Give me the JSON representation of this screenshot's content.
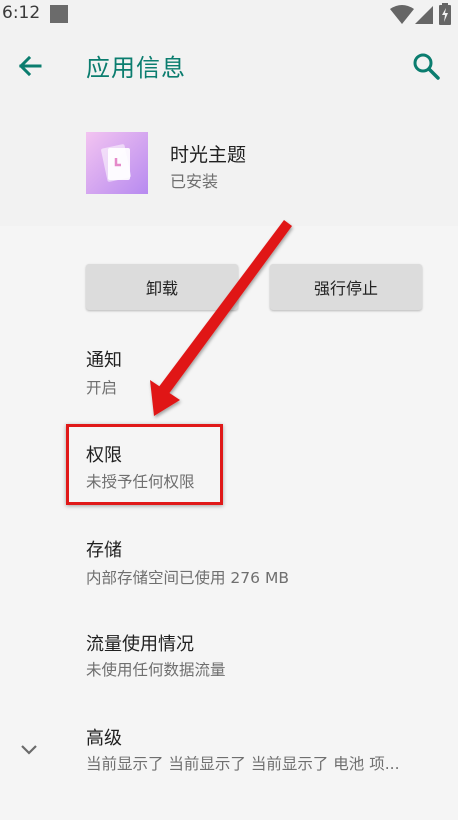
{
  "status_bar": {
    "time": "6:12",
    "icons": [
      "notification-square-icon",
      "wifi-icon",
      "cellular-signal-icon",
      "battery-charging-icon"
    ]
  },
  "app_bar": {
    "title": "应用信息",
    "back_icon": "arrow-back-icon",
    "search_icon": "search-icon"
  },
  "app": {
    "name": "时光主题",
    "status": "已安装"
  },
  "buttons": {
    "uninstall": "卸载",
    "force_stop": "强行停止"
  },
  "prefs": [
    {
      "title": "通知",
      "summary": "开启"
    },
    {
      "title": "权限",
      "summary": "未授予任何权限"
    },
    {
      "title": "存储",
      "summary": "内部存储空间已使用 276 MB"
    },
    {
      "title": "流量使用情况",
      "summary": "未使用任何数据流量"
    },
    {
      "title": "高级",
      "summary": "当前显示了 当前显示了 当前显示了 电池 项..."
    }
  ],
  "colors": {
    "accent": "#0b7d6f",
    "annotation": "#e01818",
    "app_icon_gradient_start": "#f3c4f1",
    "app_icon_gradient_end": "#b78af0"
  }
}
